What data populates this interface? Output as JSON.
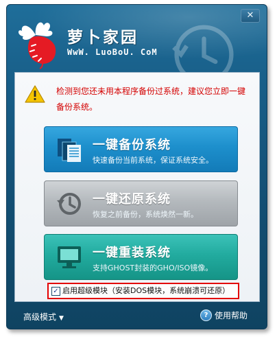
{
  "window": {
    "close_label": "✕",
    "brand_title": "萝卜家园",
    "brand_url": "WwW. LuoBoU. CoM"
  },
  "warning": {
    "text": "检测到您还未用本程序备份过系统，建议您立即一键备份系统。"
  },
  "actions": [
    {
      "title": "一键备份系统",
      "subtitle": "快速备份当前系统，保证系统安全。",
      "icon": "documents-icon",
      "color": "#1d8fcc"
    },
    {
      "title": "一键还原系统",
      "subtitle": "恢复之前备份，系统焕然一新。",
      "icon": "history-clock-icon",
      "color": "#b4b9bd"
    },
    {
      "title": "一键重装系统",
      "subtitle": "支持GHOST封装的GHO/ISO镜像。",
      "icon": "monitor-icon",
      "color": "#22ab9f"
    }
  ],
  "super_mode": {
    "checked": true,
    "label": "启用超级模块（安装DOS模块，系统崩溃可还原）"
  },
  "footer": {
    "advanced_label": "高级模式",
    "help_label": "使用帮助"
  },
  "colors": {
    "warning_text": "#d40000",
    "highlight_border": "#e30000"
  }
}
